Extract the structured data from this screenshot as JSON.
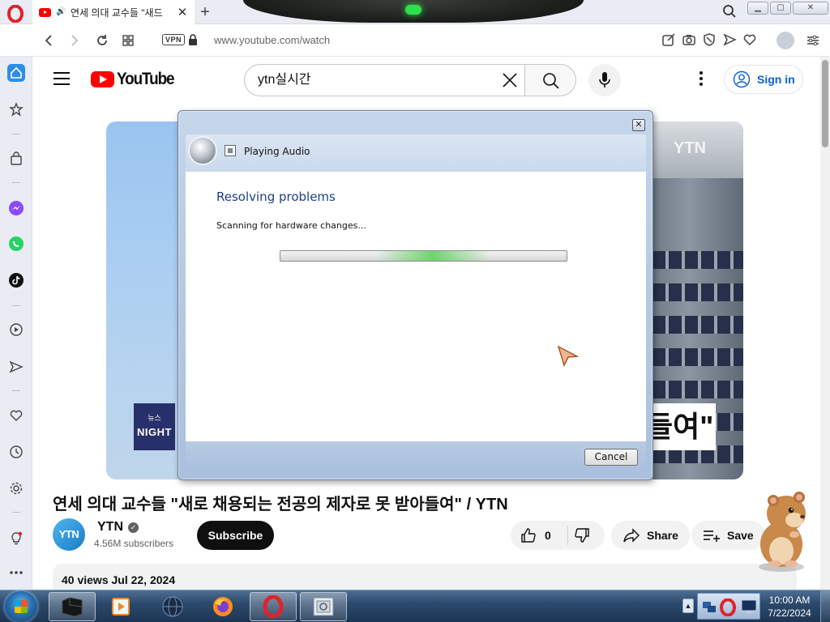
{
  "browser": {
    "tab_title": "연세 의대 교수들 \"새드",
    "tab_close": "✕",
    "new_tab": "+",
    "vpn_badge": "VPN",
    "url": "www.youtube.com/watch",
    "window_controls": [
      "minimize",
      "maximize",
      "close"
    ]
  },
  "youtube": {
    "search_query": "ytn실시간",
    "logo_text": "YouTube",
    "sign_in": "Sign in"
  },
  "video": {
    "badge_line1": "뉴스",
    "badge_line2": "NIGHT",
    "building_sign": "YTN",
    "caption_fragment": "들여\"",
    "title": "연세 의대 교수들 \"새로 채용되는 전공의 제자로 못 받아들여\" / YTN"
  },
  "channel": {
    "avatar_text": "YTN",
    "name": "YTN",
    "subscribers": "4.56M subscribers",
    "subscribe_label": "Subscribe"
  },
  "actions": {
    "like_count": "0",
    "share_label": "Share",
    "save_label": "Save"
  },
  "description": {
    "meta": "40 views  Jul 22, 2024"
  },
  "dialog": {
    "title": "Playing Audio",
    "heading": "Resolving problems",
    "status": "Scanning for hardware changes...",
    "cancel_label": "Cancel",
    "close_glyph": "✕"
  },
  "taskbar": {
    "time": "10:00 AM",
    "date": "7/22/2024"
  },
  "colors": {
    "youtube_red": "#ff0000",
    "link_blue": "#065fd4",
    "dialog_heading": "#1e3e8c",
    "progress_green": "#59d159"
  }
}
